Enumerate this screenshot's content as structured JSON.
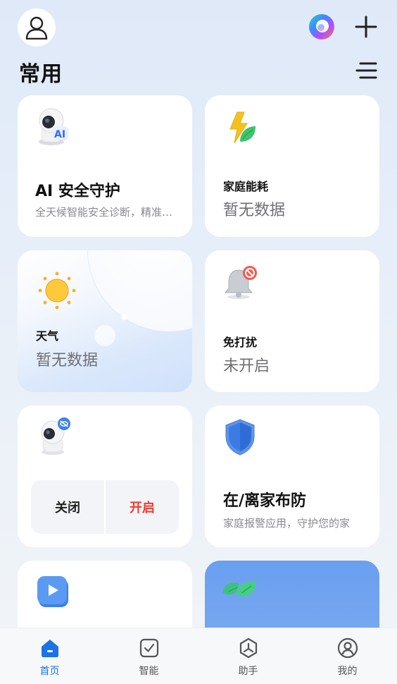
{
  "header": {
    "title": "常用"
  },
  "cards": {
    "ai_security": {
      "title": "AI 安全守护",
      "subtitle": "全天候智能安全诊断，精准守护"
    },
    "energy": {
      "title": "家庭能耗",
      "value": "暂无数据"
    },
    "weather": {
      "title": "天气",
      "value": "暂无数据"
    },
    "dnd": {
      "title": "免打扰",
      "value": "未开启"
    },
    "camera": {
      "off_label": "关闭",
      "on_label": "开启"
    },
    "arming": {
      "title": "在/离家布防",
      "subtitle": "家庭报警应用，守护您的家"
    }
  },
  "tabs": [
    {
      "label": "首页",
      "icon": "home-icon",
      "active": true
    },
    {
      "label": "智能",
      "icon": "checkbox-icon",
      "active": false
    },
    {
      "label": "助手",
      "icon": "assistant-icon",
      "active": false
    },
    {
      "label": "我的",
      "icon": "profile-icon",
      "active": false
    }
  ],
  "colors": {
    "accent": "#1a73e8",
    "danger": "#f23b30",
    "muted_text": "#6f6f73"
  }
}
